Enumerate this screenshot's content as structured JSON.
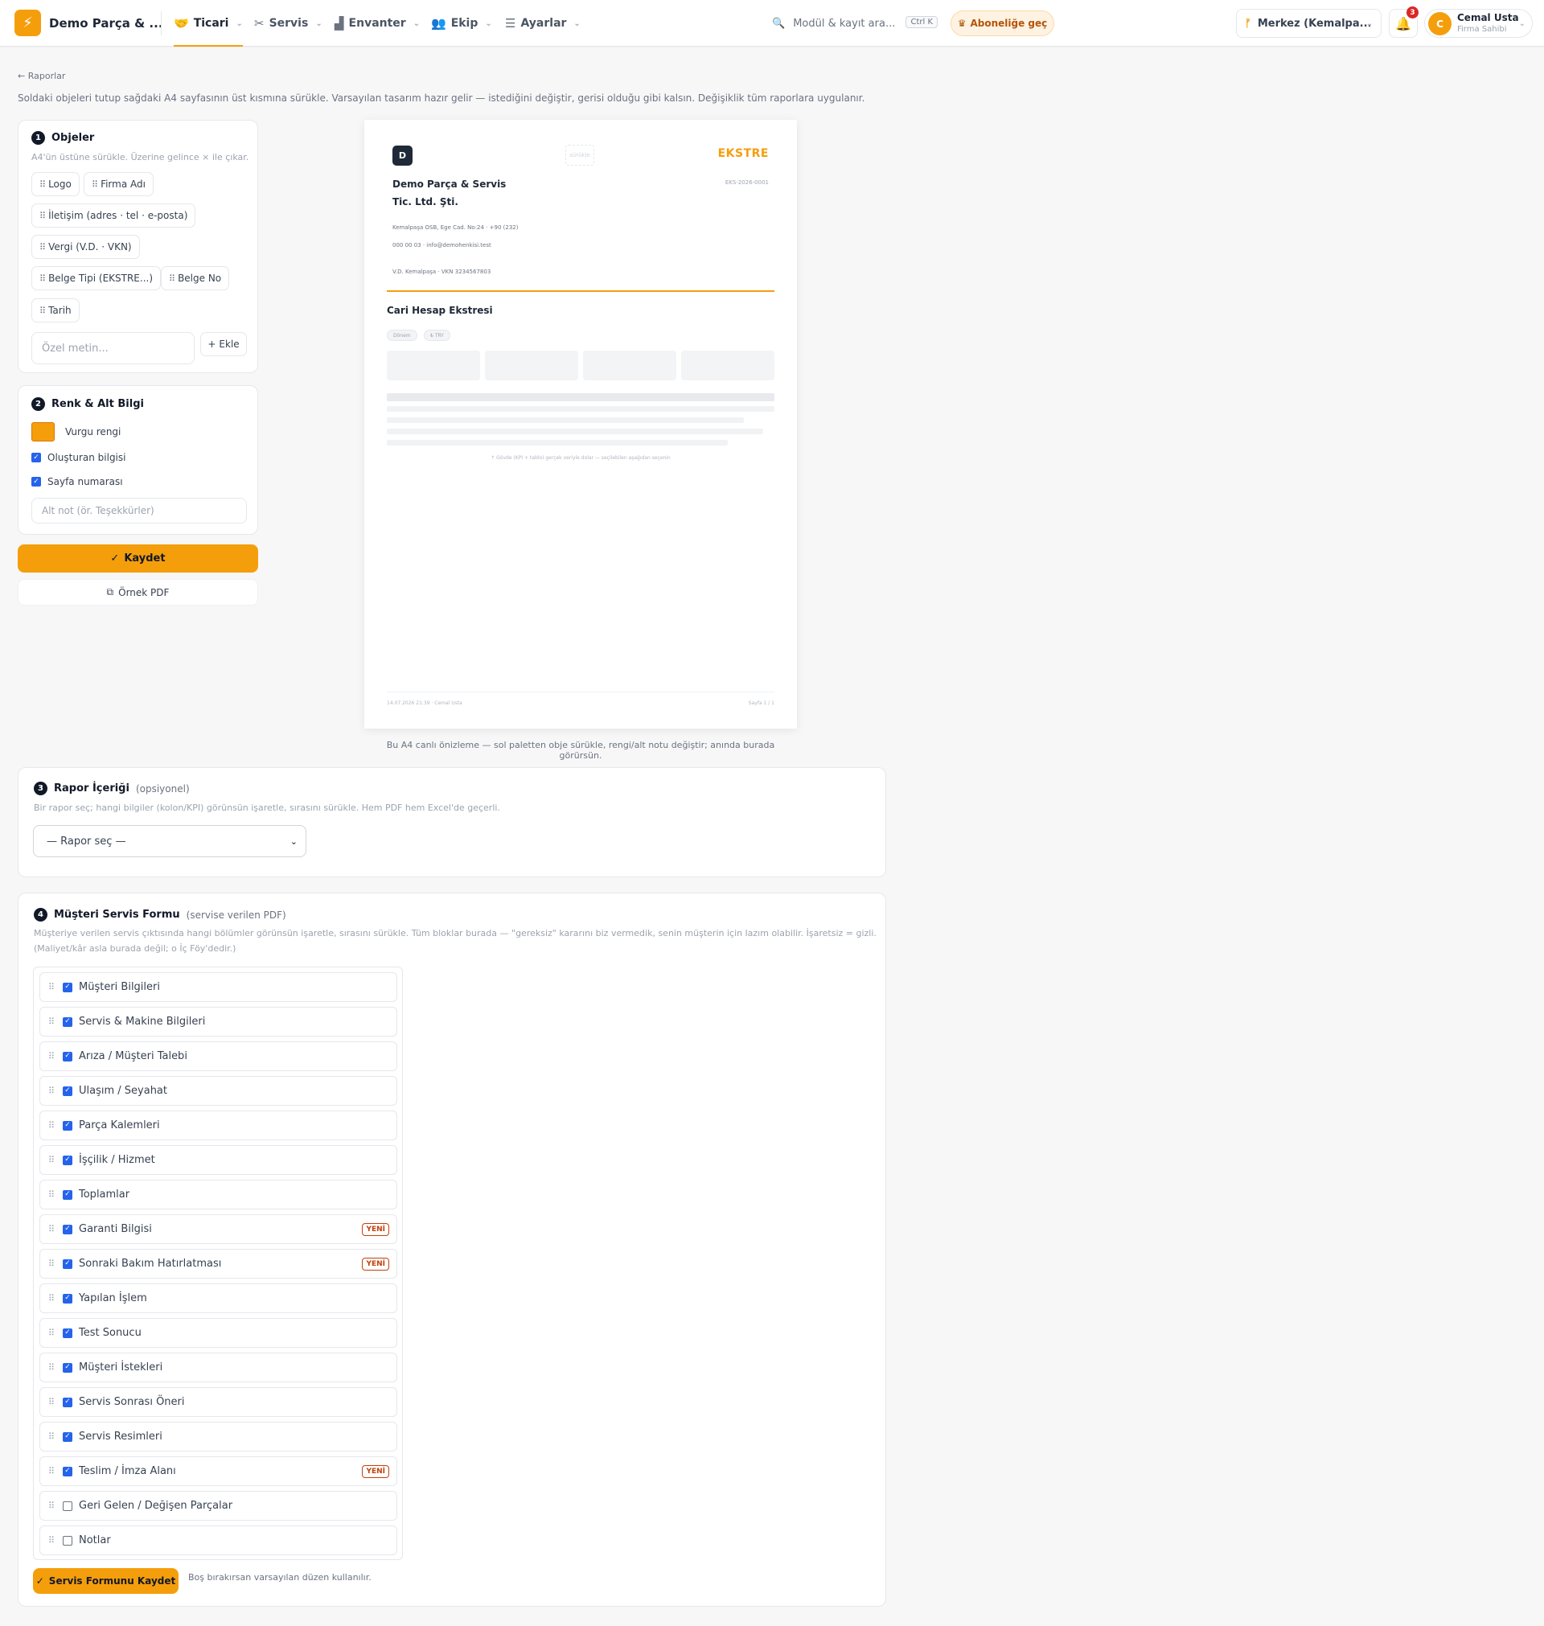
{
  "app": {
    "brand": "Demo Parça & ...",
    "accent_color": "#f59e0b",
    "nav": [
      {
        "label": "Ticari",
        "icon": "handshake-icon",
        "active": true
      },
      {
        "label": "Servis",
        "icon": "tools-icon",
        "active": false
      },
      {
        "label": "Envanter",
        "icon": "warehouse-icon",
        "active": false
      },
      {
        "label": "Ekip",
        "icon": "users-icon",
        "active": false
      },
      {
        "label": "Ayarlar",
        "icon": "sliders-icon",
        "active": false
      }
    ],
    "search": {
      "placeholder": "Modül & kayıt ara...",
      "shortcut": "Ctrl K"
    },
    "subscribe_label": "Aboneliğe geç",
    "branch": "Merkez (Kemalpa...",
    "notifications": "3",
    "user": {
      "initial": "C",
      "name": "Cemal Usta",
      "role": "Firma Sahibi"
    }
  },
  "page": {
    "back_label": "Raporlar",
    "intro": "Soldaki objeleri tutup sağdaki A4 sayfasının üst kısmına sürükle. Varsayılan tasarım hazır gelir — istediğini değiştir, gerisi olduğu gibi kalsın. Değişiklik tüm raporlara uygulanır."
  },
  "objects_card": {
    "step": "1",
    "title": "Objeler",
    "hint": "A4'ün üstüne sürükle. Üzerine gelince × ile çıkar.",
    "chips": [
      "Logo",
      "Firma Adı",
      "İletişim (adres · tel · e-posta)",
      "Vergi (V.D. · VKN)",
      "Belge Tipi (EKSTRE...)",
      "Belge No",
      "Tarih"
    ],
    "custom_placeholder": "Özel metin...",
    "add_label": "Ekle"
  },
  "color_card": {
    "step": "2",
    "title": "Renk & Alt Bilgi",
    "accent_label": "Vurgu rengi",
    "accent_color": "#f59e0b",
    "creator_label": "Oluşturan bilgisi",
    "creator_checked": true,
    "page_number_label": "Sayfa numarası",
    "page_number_checked": true,
    "footer_note_placeholder": "Alt not (ör. Teşekkürler)"
  },
  "actions": {
    "save_label": "Kaydet",
    "sample_pdf_label": "Örnek PDF"
  },
  "preview": {
    "logo_letter": "D",
    "drag_slot": "sürükle",
    "doc_type": "EKSTRE",
    "doc_no": "EKS-2026-0001",
    "company": "Demo Parça & Servis Tic. Ltd. Şti.",
    "address": "Kemalpaşa OSB, Ege Cad. No:24 · +90 (232)",
    "phone_email": "000 00 03 · info@demohenkisi.test",
    "tax": "V.D. Kemalpaşa · VKN 3234567803",
    "title": "Cari Hesap Ekstresi",
    "tags": [
      "Dönem",
      "₺ TRY"
    ],
    "note": "↑ Gövde (KPI + tablo) gerçek veriyle dolar — seçilebilen aşağıdan seçenin",
    "footer_left": "14.07.2026 21:39 · Cemal Usta",
    "footer_right": "Sayfa 1 / 1",
    "caption": "Bu A4 canlı önizleme — sol paletten obje sürükle, rengi/alt notu değiştir; anında burada görürsün."
  },
  "report_card": {
    "step": "3",
    "title": "Rapor İçeriği",
    "optional": "(opsiyonel)",
    "hint": "Bir rapor seç; hangi bilgiler (kolon/KPI) görünsün işaretle, sırasını sürükle. Hem PDF hem Excel'de geçerli.",
    "select_value": "— Rapor seç —"
  },
  "service_card": {
    "step": "4",
    "title": "Müşteri Servis Formu",
    "subtitle": "(servise verilen PDF)",
    "hint1": "Müşteriye verilen servis çıktısında hangi bölümler görünsün işaretle, sırasını sürükle. Tüm bloklar burada — \"gereksiz\" kararını biz vermedik, senin müşterin için lazım olabilir. İşaretsiz = gizli.",
    "hint2": "(Maliyet/kâr asla burada değil; o İç Föy'dedir.)",
    "new_label": "YENİ",
    "sections": [
      {
        "label": "Müşteri Bilgileri",
        "checked": true,
        "new": false
      },
      {
        "label": "Servis & Makine Bilgileri",
        "checked": true,
        "new": false
      },
      {
        "label": "Arıza / Müşteri Talebi",
        "checked": true,
        "new": false
      },
      {
        "label": "Ulaşım / Seyahat",
        "checked": true,
        "new": false
      },
      {
        "label": "Parça Kalemleri",
        "checked": true,
        "new": false
      },
      {
        "label": "İşçilik / Hizmet",
        "checked": true,
        "new": false
      },
      {
        "label": "Toplamlar",
        "checked": true,
        "new": false
      },
      {
        "label": "Garanti Bilgisi",
        "checked": true,
        "new": true
      },
      {
        "label": "Sonraki Bakım Hatırlatması",
        "checked": true,
        "new": true
      },
      {
        "label": "Yapılan İşlem",
        "checked": true,
        "new": false
      },
      {
        "label": "Test Sonucu",
        "checked": true,
        "new": false
      },
      {
        "label": "Müşteri İstekleri",
        "checked": true,
        "new": false
      },
      {
        "label": "Servis Sonrası Öneri",
        "checked": true,
        "new": false
      },
      {
        "label": "Servis Resimleri",
        "checked": true,
        "new": false
      },
      {
        "label": "Teslim / İmza Alanı",
        "checked": true,
        "new": true
      },
      {
        "label": "Geri Gelen / Değişen Parçalar",
        "checked": false,
        "new": false
      },
      {
        "label": "Notlar",
        "checked": false,
        "new": false
      }
    ],
    "save_label": "Servis Formunu Kaydet",
    "save_note": "Boş bırakırsan varsayılan düzen kullanılır."
  }
}
